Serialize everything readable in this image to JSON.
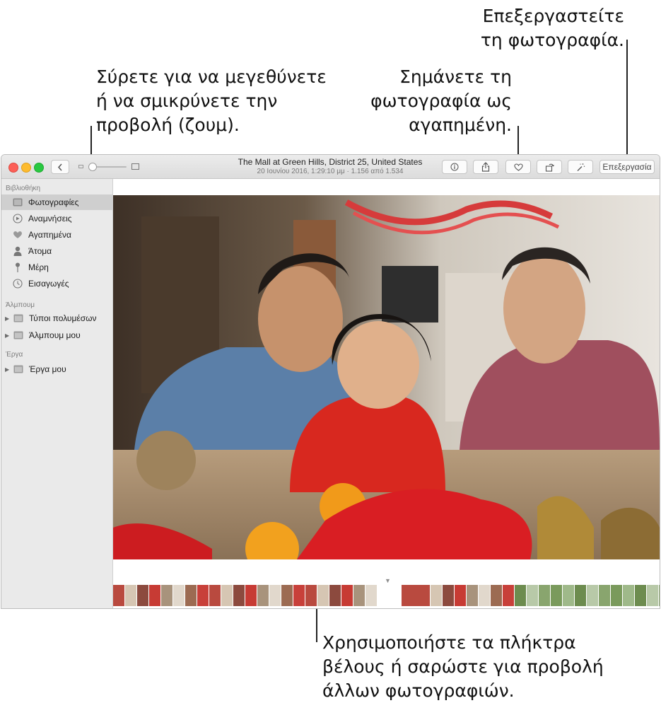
{
  "callouts": {
    "zoom": [
      "Σύρετε για να μεγεθύνετε",
      "ή να σμικρύνετε την",
      "προβολή (ζουμ)."
    ],
    "favorite": [
      "Σημάνετε τη",
      "φωτογραφία ως",
      "αγαπημένη."
    ],
    "edit": [
      "Επεξεργαστείτε",
      "τη φωτογραφία."
    ],
    "navigate": [
      "Χρησιμοποιήστε τα πλήκτρα",
      "βέλους ή σαρώστε για προβολή",
      "άλλων φωτογραφιών."
    ]
  },
  "window": {
    "title": "The Mall at Green Hills, District 25, United States",
    "subtitle": "20 Ιουνίου 2016, 1:29:10 μμ  ·  1.156 από 1.534",
    "edit_button": "Επεξεργασία",
    "icons": {
      "back": "chevron-left-icon",
      "info": "info-icon",
      "share": "share-icon",
      "favorite": "heart-icon",
      "rotate": "rotate-icon",
      "enhance": "magic-wand-icon"
    }
  },
  "sidebar": {
    "library_header": "Βιβλιοθήκη",
    "library": [
      {
        "label": "Φωτογραφίες",
        "icon": "photos-icon",
        "selected": true
      },
      {
        "label": "Αναμνήσεις",
        "icon": "memories-icon"
      },
      {
        "label": "Αγαπημένα",
        "icon": "heart-icon"
      },
      {
        "label": "Άτομα",
        "icon": "person-icon"
      },
      {
        "label": "Μέρη",
        "icon": "pin-icon"
      },
      {
        "label": "Εισαγωγές",
        "icon": "clock-icon"
      }
    ],
    "albums_header": "Άλμπουμ",
    "albums": [
      {
        "label": "Τύποι πολυμέσων",
        "icon": "folder-icon"
      },
      {
        "label": "Άλμπουμ μου",
        "icon": "folder-icon"
      }
    ],
    "projects_header": "Έργα",
    "projects": [
      {
        "label": "Έργα μου",
        "icon": "folder-icon"
      }
    ]
  },
  "colors": {
    "titlebar": "#dcdcdc",
    "sidebar": "#eaeaea",
    "selection": "#cfcfcf"
  }
}
